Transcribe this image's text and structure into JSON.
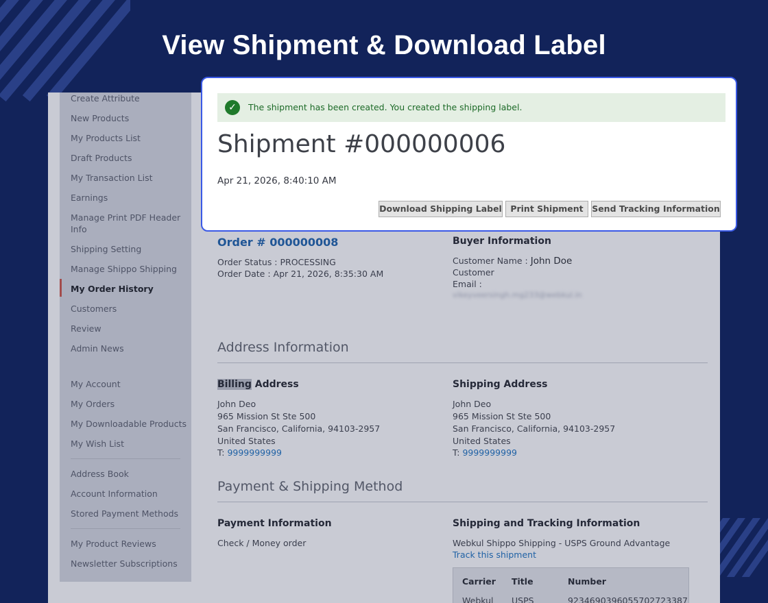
{
  "headline": "View Shipment & Download Label",
  "sidebar": {
    "items": [
      {
        "label": "Create Attribute"
      },
      {
        "label": "New Products"
      },
      {
        "label": "My Products List"
      },
      {
        "label": "Draft Products"
      },
      {
        "label": "My Transaction List"
      },
      {
        "label": "Earnings"
      },
      {
        "label": "Manage Print PDF Header Info"
      },
      {
        "label": "Shipping Setting"
      },
      {
        "label": "Manage Shippo Shipping"
      },
      {
        "label": "My Order History"
      },
      {
        "label": "Customers"
      },
      {
        "label": "Review"
      },
      {
        "label": "Admin News"
      },
      {
        "label": "My Account"
      },
      {
        "label": "My Orders"
      },
      {
        "label": "My Downloadable Products"
      },
      {
        "label": "My Wish List"
      },
      {
        "label": "Address Book"
      },
      {
        "label": "Account Information"
      },
      {
        "label": "Stored Payment Methods"
      },
      {
        "label": "My Product Reviews"
      },
      {
        "label": "Newsletter Subscriptions"
      }
    ],
    "active": "My Order History"
  },
  "modal": {
    "success_message": "The shipment has been created. You created the shipping label.",
    "title": "Shipment #000000006",
    "date": "Apr 21, 2026, 8:40:10 AM",
    "buttons": {
      "download": "Download Shipping Label",
      "print": "Print Shipment",
      "send_tracking": "Send Tracking Information"
    }
  },
  "order": {
    "title": "Order # 000000008",
    "status": "Order Status : PROCESSING",
    "date": "Order Date : Apr 21, 2026, 8:35:30 AM"
  },
  "buyer": {
    "heading": "Buyer Information",
    "name_label": "Customer Name :",
    "name_value": "John Doe",
    "group": "Customer",
    "email_label": "Email :",
    "email_value": "vikeyveersingh.mg233@webkul.in"
  },
  "address_section": {
    "title": "Address Information",
    "billing": {
      "heading_highlight": "Billing",
      "heading_rest": " Address",
      "name": "John Deo",
      "street": "965 Mission St Ste 500",
      "city": "San Francisco, California, 94103-2957",
      "country": "United States",
      "phone_prefix": "T: ",
      "phone": "9999999999"
    },
    "shipping": {
      "heading": "Shipping Address",
      "name": "John Deo",
      "street": "965 Mission St Ste 500",
      "city": "San Francisco, California, 94103-2957",
      "country": "United States",
      "phone_prefix": "T: ",
      "phone": "9999999999"
    }
  },
  "payment_section": {
    "title": "Payment & Shipping Method",
    "payment_heading": "Payment Information",
    "payment_method": "Check / Money order",
    "tracking_heading": "Shipping and Tracking Information",
    "shipping_method": "Webkul Shippo Shipping - USPS Ground Advantage",
    "track_link": "Track this shipment",
    "table": {
      "headers": [
        "Carrier",
        "Title",
        "Number"
      ],
      "row": [
        "Webkul",
        "USPS",
        "9234690396055702723387"
      ]
    }
  },
  "colors": {
    "background": "#12235a",
    "modal_border": "#3a59e6",
    "success_bg": "#e4efe3",
    "success_icon": "#1f7a2b",
    "link": "#2062a5"
  }
}
